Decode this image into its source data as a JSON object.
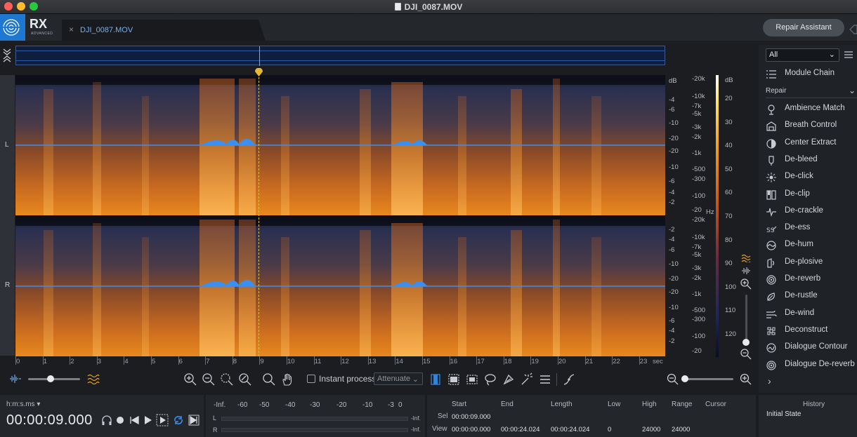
{
  "window": {
    "title": "DJI_0087.MOV"
  },
  "header": {
    "product": "RX",
    "product_sub": "ADVANCED",
    "file_tab": "DJI_0087.MOV",
    "file_tab_close": "×",
    "repair_assistant": "Repair Assistant"
  },
  "channels": {
    "left": "L",
    "right": "R"
  },
  "db_scale_top": [
    "dB",
    "-4",
    "-6",
    "-10",
    "-20",
    "-20",
    "-10",
    "-6",
    "-4",
    "-2"
  ],
  "db_scale_bottom": [
    "-2",
    "-4",
    "-6",
    "-10",
    "-20",
    "-20",
    "-10",
    "-6",
    "-4",
    "-2"
  ],
  "hz_scale_top": [
    "-20k",
    "-10k",
    "-7k",
    "-5k",
    "-3k",
    "-2k",
    "-1k",
    "-500",
    "-300",
    "-100",
    "-20"
  ],
  "hz_unit": "Hz",
  "hz_scale_bottom": [
    "-20k",
    "-10k",
    "-7k",
    "-5k",
    "-3k",
    "-2k",
    "-1k",
    "-500",
    "-300",
    "-100",
    "-20"
  ],
  "colorbar_scale": [
    "dB",
    "20",
    "30",
    "40",
    "50",
    "60",
    "70",
    "80",
    "90",
    "100",
    "110",
    "120"
  ],
  "time_ruler": [
    "0",
    "1",
    "2",
    "3",
    "4",
    "5",
    "6",
    "7",
    "8",
    "9",
    "10",
    "11",
    "12",
    "13",
    "14",
    "15",
    "16",
    "17",
    "18",
    "19",
    "20",
    "21",
    "22",
    "23"
  ],
  "time_unit": "sec",
  "toolbar": {
    "instant_process": "Instant process",
    "attenuate": "Attenuate"
  },
  "modules": {
    "filter": "All",
    "module_chain": "Module Chain",
    "group": "Repair",
    "items": [
      {
        "label": "Ambience Match",
        "icon": "ambience-match-icon"
      },
      {
        "label": "Breath Control",
        "icon": "breath-control-icon"
      },
      {
        "label": "Center Extract",
        "icon": "center-extract-icon"
      },
      {
        "label": "De-bleed",
        "icon": "de-bleed-icon"
      },
      {
        "label": "De-click",
        "icon": "de-click-icon"
      },
      {
        "label": "De-clip",
        "icon": "de-clip-icon"
      },
      {
        "label": "De-crackle",
        "icon": "de-crackle-icon"
      },
      {
        "label": "De-ess",
        "icon": "de-ess-icon"
      },
      {
        "label": "De-hum",
        "icon": "de-hum-icon"
      },
      {
        "label": "De-plosive",
        "icon": "de-plosive-icon"
      },
      {
        "label": "De-reverb",
        "icon": "de-reverb-icon"
      },
      {
        "label": "De-rustle",
        "icon": "de-rustle-icon"
      },
      {
        "label": "De-wind",
        "icon": "de-wind-icon"
      },
      {
        "label": "Deconstruct",
        "icon": "deconstruct-icon"
      },
      {
        "label": "Dialogue Contour",
        "icon": "dialogue-contour-icon"
      },
      {
        "label": "Dialogue De-reverb",
        "icon": "dialogue-de-reverb-icon"
      }
    ]
  },
  "transport": {
    "time_format": "h:m:s.ms",
    "timecode": "00:00:09.000"
  },
  "meter": {
    "scale": [
      "-Inf.",
      "-60",
      "-50",
      "-40",
      "-30",
      "-20",
      "-10",
      "-3",
      "0"
    ],
    "left": "L",
    "right": "R",
    "left_peak": "-Inf.",
    "right_peak": "-Inf."
  },
  "selection": {
    "headers": [
      "Start",
      "End",
      "Length",
      "Low",
      "High",
      "Range",
      "Cursor"
    ],
    "sel_label": "Sel",
    "view_label": "View",
    "sel_start": "00:00:09.000",
    "view_start": "00:00:00.000",
    "view_end": "00:00:24.024",
    "view_length": "00:00:24.024",
    "low": "0",
    "high": "24000",
    "range": "24000"
  },
  "history": {
    "title": "History",
    "item": "Initial State"
  },
  "colors": {
    "accent": "#1e78d2",
    "waveform": "#3b8ff0",
    "playhead": "#e8b830"
  }
}
